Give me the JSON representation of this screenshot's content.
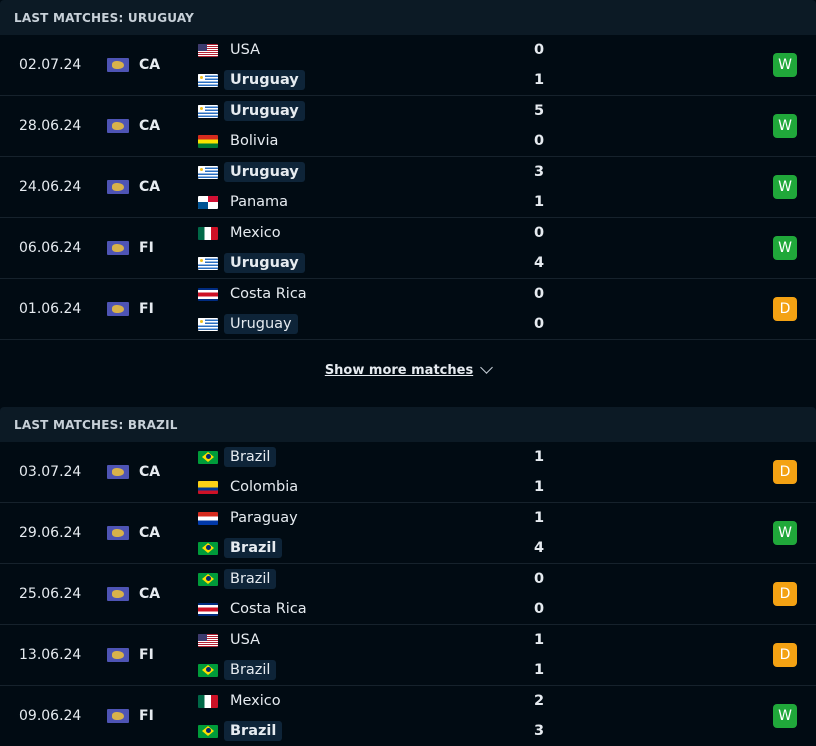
{
  "sections": [
    {
      "title": "LAST MATCHES: URUGUAY",
      "matches": [
        {
          "date": "02.07.24",
          "comp": "CA",
          "home": {
            "name": "USA",
            "flag": "usa",
            "highlight": false,
            "winner": false
          },
          "away": {
            "name": "Uruguay",
            "flag": "uru",
            "highlight": true,
            "winner": true
          },
          "home_score": "0",
          "away_score": "1",
          "result": "W"
        },
        {
          "date": "28.06.24",
          "comp": "CA",
          "home": {
            "name": "Uruguay",
            "flag": "uru",
            "highlight": true,
            "winner": true
          },
          "away": {
            "name": "Bolivia",
            "flag": "bol",
            "highlight": false,
            "winner": false
          },
          "home_score": "5",
          "away_score": "0",
          "result": "W"
        },
        {
          "date": "24.06.24",
          "comp": "CA",
          "home": {
            "name": "Uruguay",
            "flag": "uru",
            "highlight": true,
            "winner": true
          },
          "away": {
            "name": "Panama",
            "flag": "pan",
            "highlight": false,
            "winner": false
          },
          "home_score": "3",
          "away_score": "1",
          "result": "W"
        },
        {
          "date": "06.06.24",
          "comp": "FI",
          "home": {
            "name": "Mexico",
            "flag": "mex",
            "highlight": false,
            "winner": false
          },
          "away": {
            "name": "Uruguay",
            "flag": "uru",
            "highlight": true,
            "winner": true
          },
          "home_score": "0",
          "away_score": "4",
          "result": "W"
        },
        {
          "date": "01.06.24",
          "comp": "FI",
          "home": {
            "name": "Costa Rica",
            "flag": "crc",
            "highlight": false,
            "winner": false
          },
          "away": {
            "name": "Uruguay",
            "flag": "uru",
            "highlight": true,
            "winner": false
          },
          "home_score": "0",
          "away_score": "0",
          "result": "D"
        }
      ],
      "show_more": "Show more matches"
    },
    {
      "title": "LAST MATCHES: BRAZIL",
      "matches": [
        {
          "date": "03.07.24",
          "comp": "CA",
          "home": {
            "name": "Brazil",
            "flag": "bra",
            "highlight": true,
            "winner": false
          },
          "away": {
            "name": "Colombia",
            "flag": "col",
            "highlight": false,
            "winner": false
          },
          "home_score": "1",
          "away_score": "1",
          "result": "D"
        },
        {
          "date": "29.06.24",
          "comp": "CA",
          "home": {
            "name": "Paraguay",
            "flag": "par",
            "highlight": false,
            "winner": false
          },
          "away": {
            "name": "Brazil",
            "flag": "bra",
            "highlight": true,
            "winner": true
          },
          "home_score": "1",
          "away_score": "4",
          "result": "W"
        },
        {
          "date": "25.06.24",
          "comp": "CA",
          "home": {
            "name": "Brazil",
            "flag": "bra",
            "highlight": true,
            "winner": false
          },
          "away": {
            "name": "Costa Rica",
            "flag": "crc",
            "highlight": false,
            "winner": false
          },
          "home_score": "0",
          "away_score": "0",
          "result": "D"
        },
        {
          "date": "13.06.24",
          "comp": "FI",
          "home": {
            "name": "USA",
            "flag": "usa",
            "highlight": false,
            "winner": false
          },
          "away": {
            "name": "Brazil",
            "flag": "bra",
            "highlight": true,
            "winner": false
          },
          "home_score": "1",
          "away_score": "1",
          "result": "D"
        },
        {
          "date": "09.06.24",
          "comp": "FI",
          "home": {
            "name": "Mexico",
            "flag": "mex",
            "highlight": false,
            "winner": false
          },
          "away": {
            "name": "Brazil",
            "flag": "bra",
            "highlight": true,
            "winner": true
          },
          "home_score": "2",
          "away_score": "3",
          "result": "W"
        }
      ]
    }
  ]
}
